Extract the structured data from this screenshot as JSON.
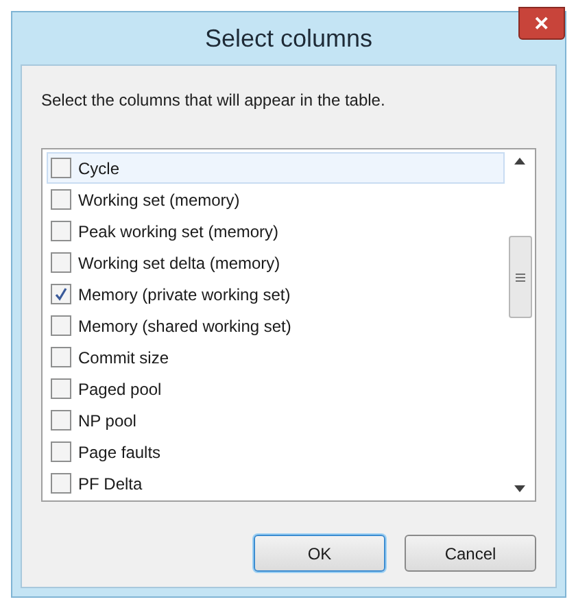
{
  "window": {
    "title": "Select columns",
    "close": "✕"
  },
  "instruction": "Select the columns that will appear in the table.",
  "columns": [
    {
      "label": "Cycle",
      "checked": false,
      "selected": true
    },
    {
      "label": "Working set (memory)",
      "checked": false,
      "selected": false
    },
    {
      "label": "Peak working set (memory)",
      "checked": false,
      "selected": false
    },
    {
      "label": "Working set delta (memory)",
      "checked": false,
      "selected": false
    },
    {
      "label": "Memory (private working set)",
      "checked": true,
      "selected": false
    },
    {
      "label": "Memory (shared working set)",
      "checked": false,
      "selected": false
    },
    {
      "label": "Commit size",
      "checked": false,
      "selected": false
    },
    {
      "label": "Paged pool",
      "checked": false,
      "selected": false
    },
    {
      "label": "NP pool",
      "checked": false,
      "selected": false
    },
    {
      "label": "Page faults",
      "checked": false,
      "selected": false
    },
    {
      "label": "PF Delta",
      "checked": false,
      "selected": false
    }
  ],
  "buttons": [
    {
      "label": "OK",
      "default": true
    },
    {
      "label": "Cancel",
      "default": false
    }
  ]
}
